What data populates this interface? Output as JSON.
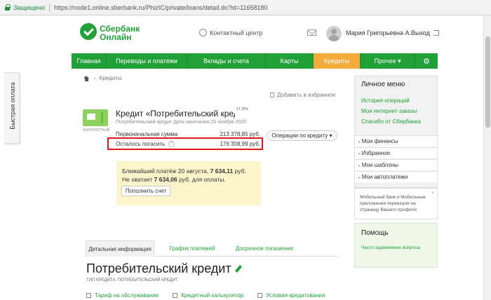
{
  "browser": {
    "secure_label": "Защищено",
    "url": "https://node1.online.sberbank.ru/PhizIC/private/loans/detail.do?id=11658180"
  },
  "side_tab": {
    "label": "Быстрая оплата"
  },
  "header": {
    "logo_line1": "Сбербанк",
    "logo_line2": "Онлайн",
    "contact_center": "Контактный центр",
    "user_name": "Мария Григорьевна А.",
    "logout": "Выход"
  },
  "nav": {
    "items": [
      {
        "label": "Главная"
      },
      {
        "label": "Переводы и платежи"
      },
      {
        "label": "Вклады и счета"
      },
      {
        "label": "Карты"
      },
      {
        "label": "Кредиты"
      },
      {
        "label": "Прочее ▾"
      }
    ],
    "active_index": 4,
    "accent": "#21a038",
    "active_color": "#f3ab3a"
  },
  "breadcrumb": {
    "item": "Кредиты"
  },
  "favorites_link": "Добавить в избранное",
  "loan": {
    "icon_caption": "АННУИТЕТНЫЙ",
    "title": "Кредит «Потребительский кредит»",
    "rate": "17.25%",
    "subtitle": "Потребительский кредит  Дата окончания 20 ноября 2020",
    "initial_label": "Первоначальная сумма",
    "initial_value": "213 378,85 руб.",
    "remaining_label": "Осталось погасить",
    "remaining_hint": "?",
    "remaining_value": "176 308,99 руб.",
    "operations_button": "Операции по кредиту ▾"
  },
  "notice": {
    "line1_prefix": "Ближайший платёж 20 августа, ",
    "line1_amount": "7 634,11",
    "line1_suffix": " руб.",
    "line2_prefix": "Не хватает ",
    "line2_amount": "7 634,06",
    "line2_suffix": " руб. для оплаты.",
    "topup_button": "Пополнить счет"
  },
  "tabs": [
    {
      "label": "Детальная информация"
    },
    {
      "label": "График платежей"
    },
    {
      "label": "Досрочное погашение"
    }
  ],
  "detail": {
    "title": "Потребительский кредит",
    "type_line": "ТИП КРЕДИТА: ПОТРЕБИТЕЛЬСКИЙ КРЕДИТ",
    "links": [
      "Тариф на обслуживание",
      "Кредитный калькулятор",
      "Условия кредитования"
    ]
  },
  "personal_menu": {
    "title": "Личное меню",
    "links": [
      "История операций",
      "Мои интернет-заказы",
      "Спасибо от Сбербанка"
    ],
    "sections": [
      "Мои финансы",
      "Избранное",
      "Мои шаблоны",
      "Мои автоплатежи"
    ]
  },
  "promo": {
    "text": "Мобильный банк и Мобильные приложения переехали на страницу Вашего профиля",
    "close": "×"
  },
  "help": {
    "title": "Помощь",
    "link": "Часто задаваемые вопросы"
  }
}
